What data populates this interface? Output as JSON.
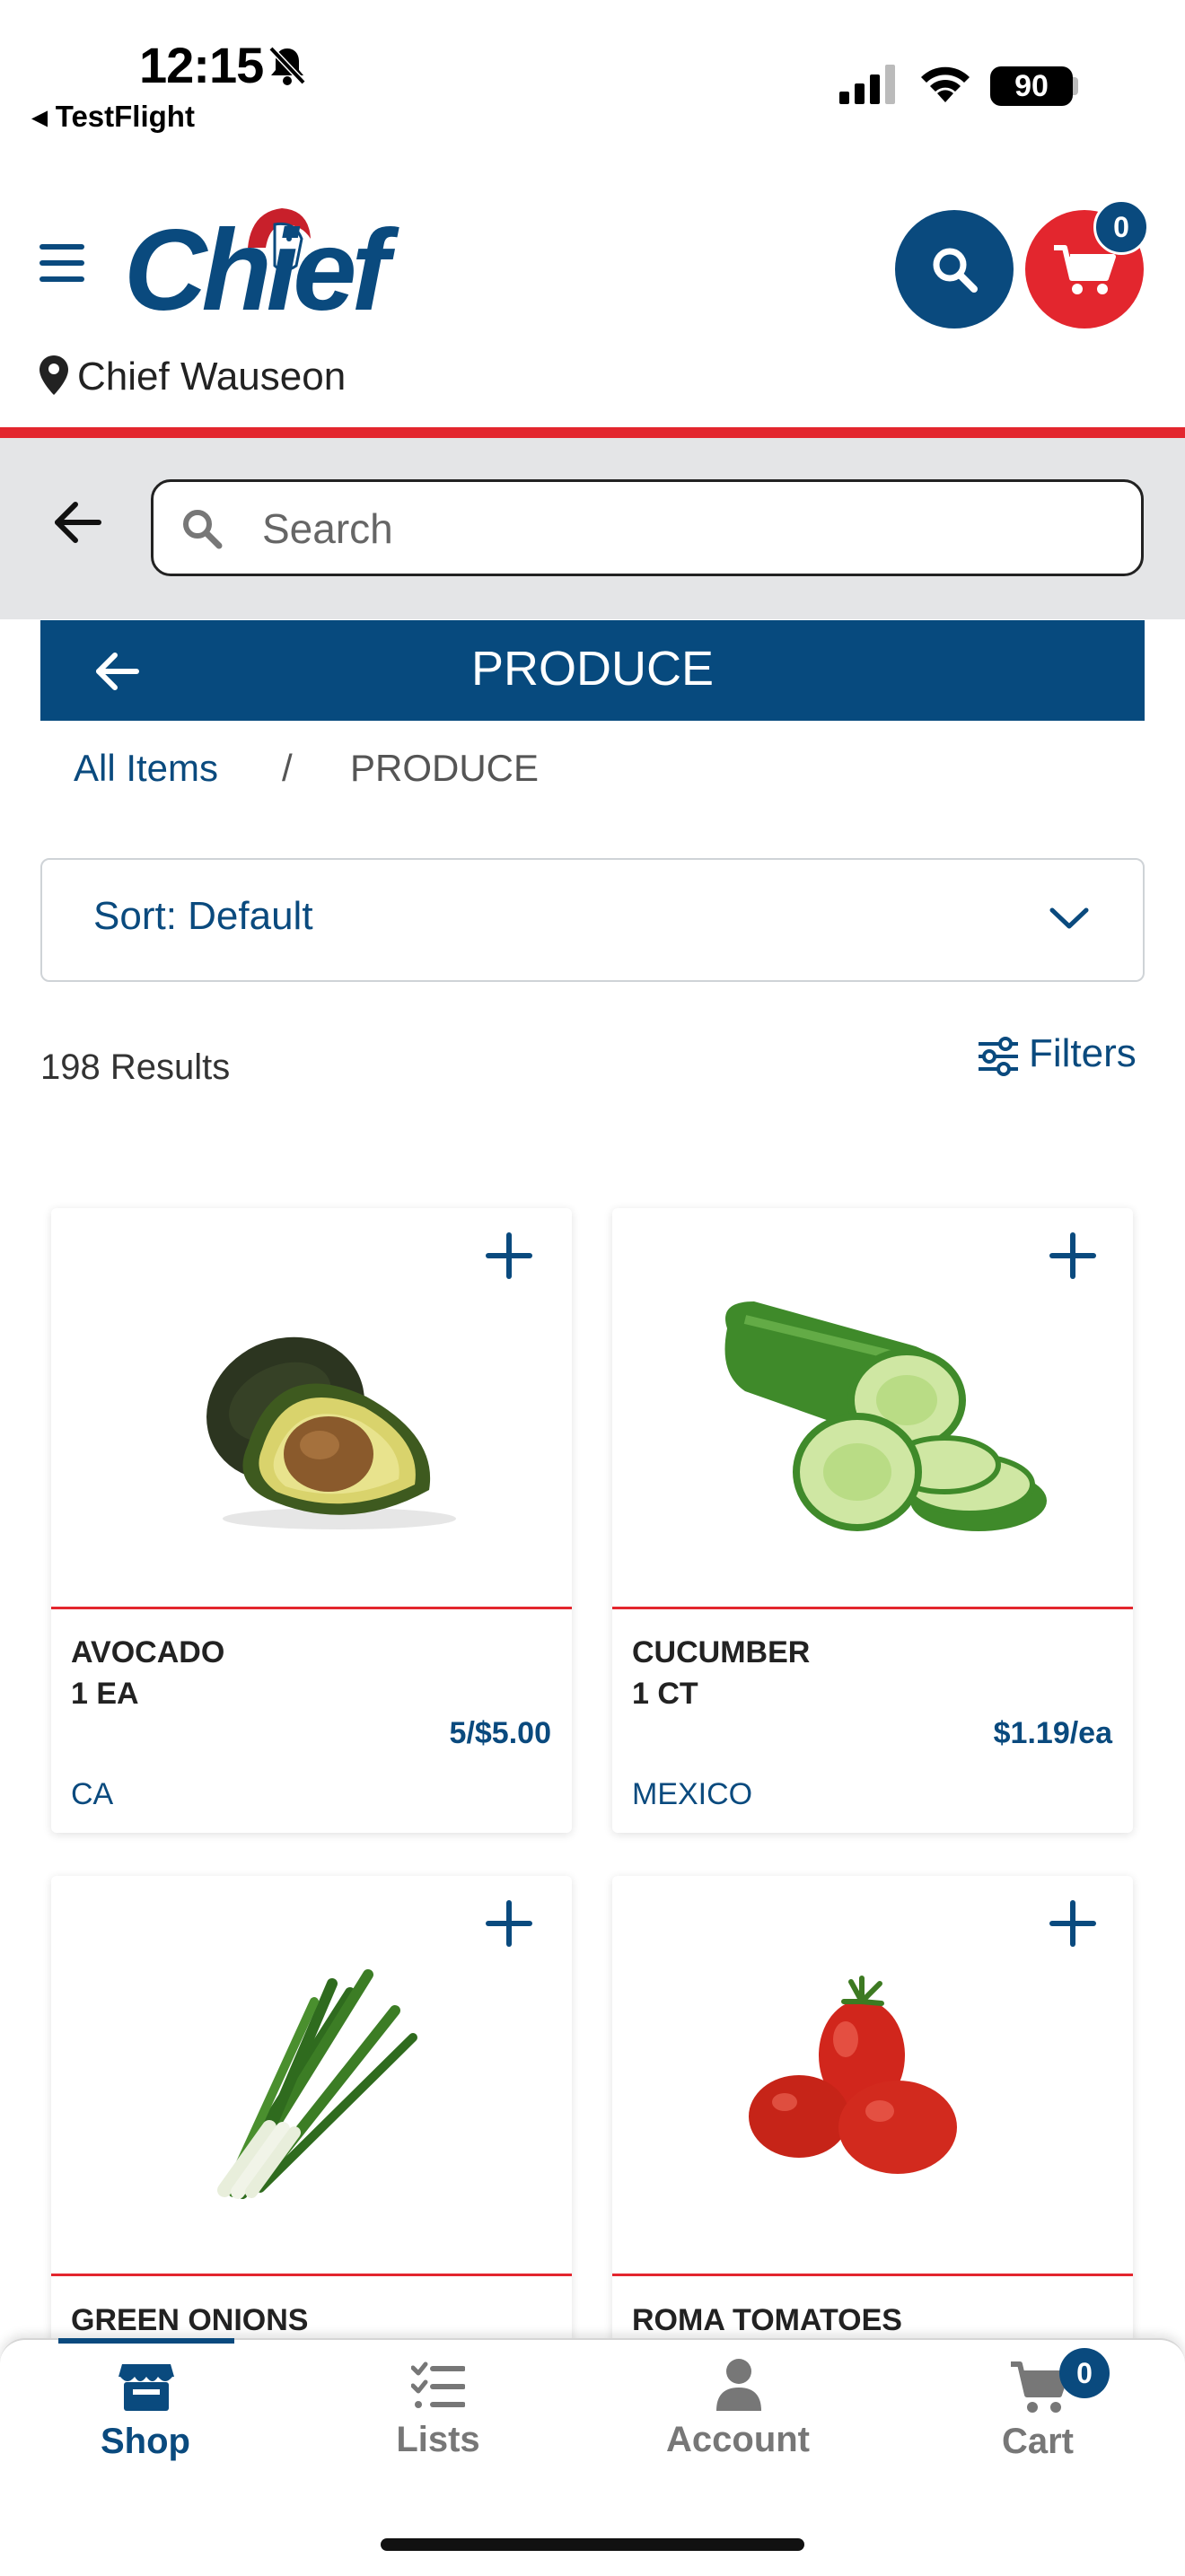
{
  "status_bar": {
    "time": "12:15",
    "back_app": "TestFlight",
    "battery": "90"
  },
  "header": {
    "brand": "Chief",
    "location": "Chief Wauseon",
    "cart_count": "0"
  },
  "search": {
    "placeholder": "Search"
  },
  "category": {
    "title": "PRODUCE"
  },
  "breadcrumb": {
    "all": "All Items",
    "separator": "/",
    "current": "PRODUCE"
  },
  "sort": {
    "label": "Sort: Default"
  },
  "results": {
    "count_text": "198 Results",
    "filters_label": "Filters"
  },
  "products": [
    {
      "name": "AVOCADO",
      "size": "1 EA",
      "price": "5/$5.00",
      "origin": "CA"
    },
    {
      "name": "CUCUMBER",
      "size": "1 CT",
      "price": "$1.19/ea",
      "origin": "MEXICO"
    },
    {
      "name": "GREEN ONIONS",
      "size": "",
      "price": "",
      "origin": ""
    },
    {
      "name": "ROMA TOMATOES",
      "size": "",
      "price": "",
      "origin": ""
    }
  ],
  "bottom_nav": {
    "items": [
      {
        "label": "Shop",
        "icon": "store-icon",
        "active": true
      },
      {
        "label": "Lists",
        "icon": "checklist-icon",
        "active": false
      },
      {
        "label": "Account",
        "icon": "person-icon",
        "active": false
      },
      {
        "label": "Cart",
        "icon": "cart-icon",
        "active": false
      }
    ],
    "cart_badge": "0"
  },
  "colors": {
    "brand_blue": "#0a4a7e",
    "brand_red": "#e3262e"
  }
}
